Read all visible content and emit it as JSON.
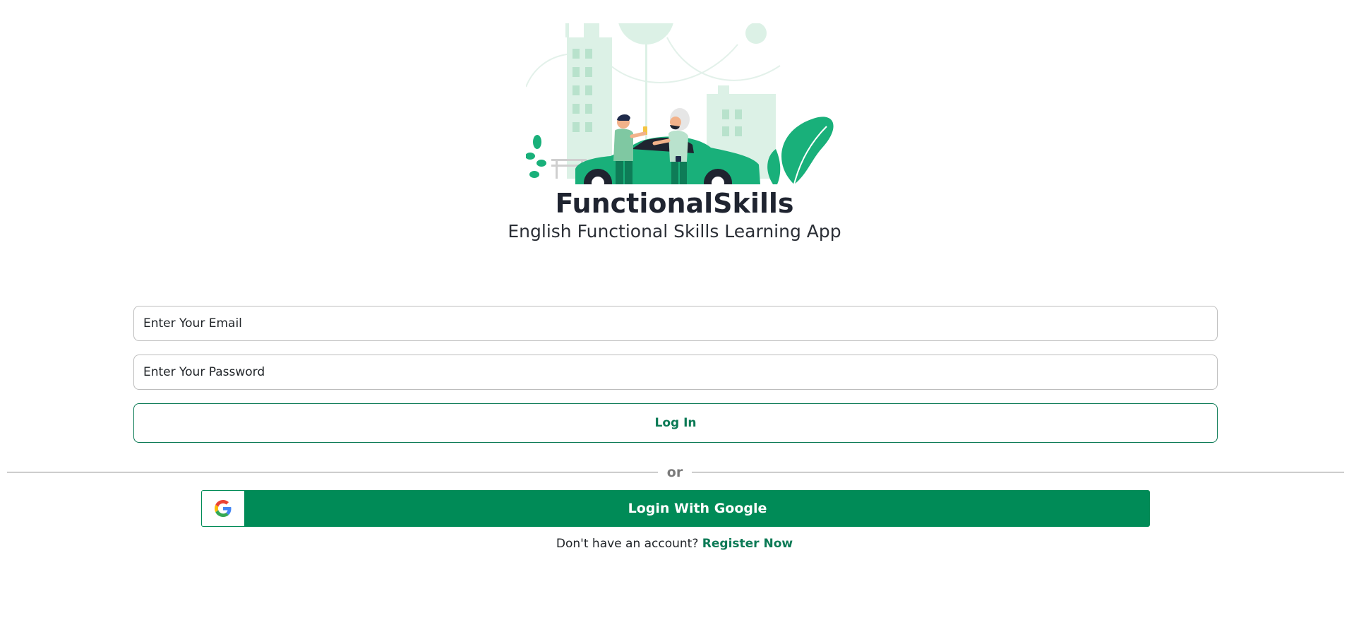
{
  "brand": {
    "title": "FunctionalSkills",
    "subtitle": "English Functional Skills Learning App"
  },
  "colors": {
    "accent": "#0b7a55",
    "google_button": "#008b57",
    "illustration_light": "#dcf1e6",
    "illustration_mid": "#19b07a"
  },
  "form": {
    "email_placeholder": "Enter Your Email",
    "password_placeholder": "Enter Your Password",
    "login_label": "Log In"
  },
  "divider": {
    "text": "or"
  },
  "google": {
    "label": "Login With Google",
    "icon": "google-g-icon"
  },
  "register": {
    "prompt": "Don't have an account?",
    "link_label": "Register Now"
  },
  "illustration": {
    "icon": "car-handover-illustration"
  }
}
